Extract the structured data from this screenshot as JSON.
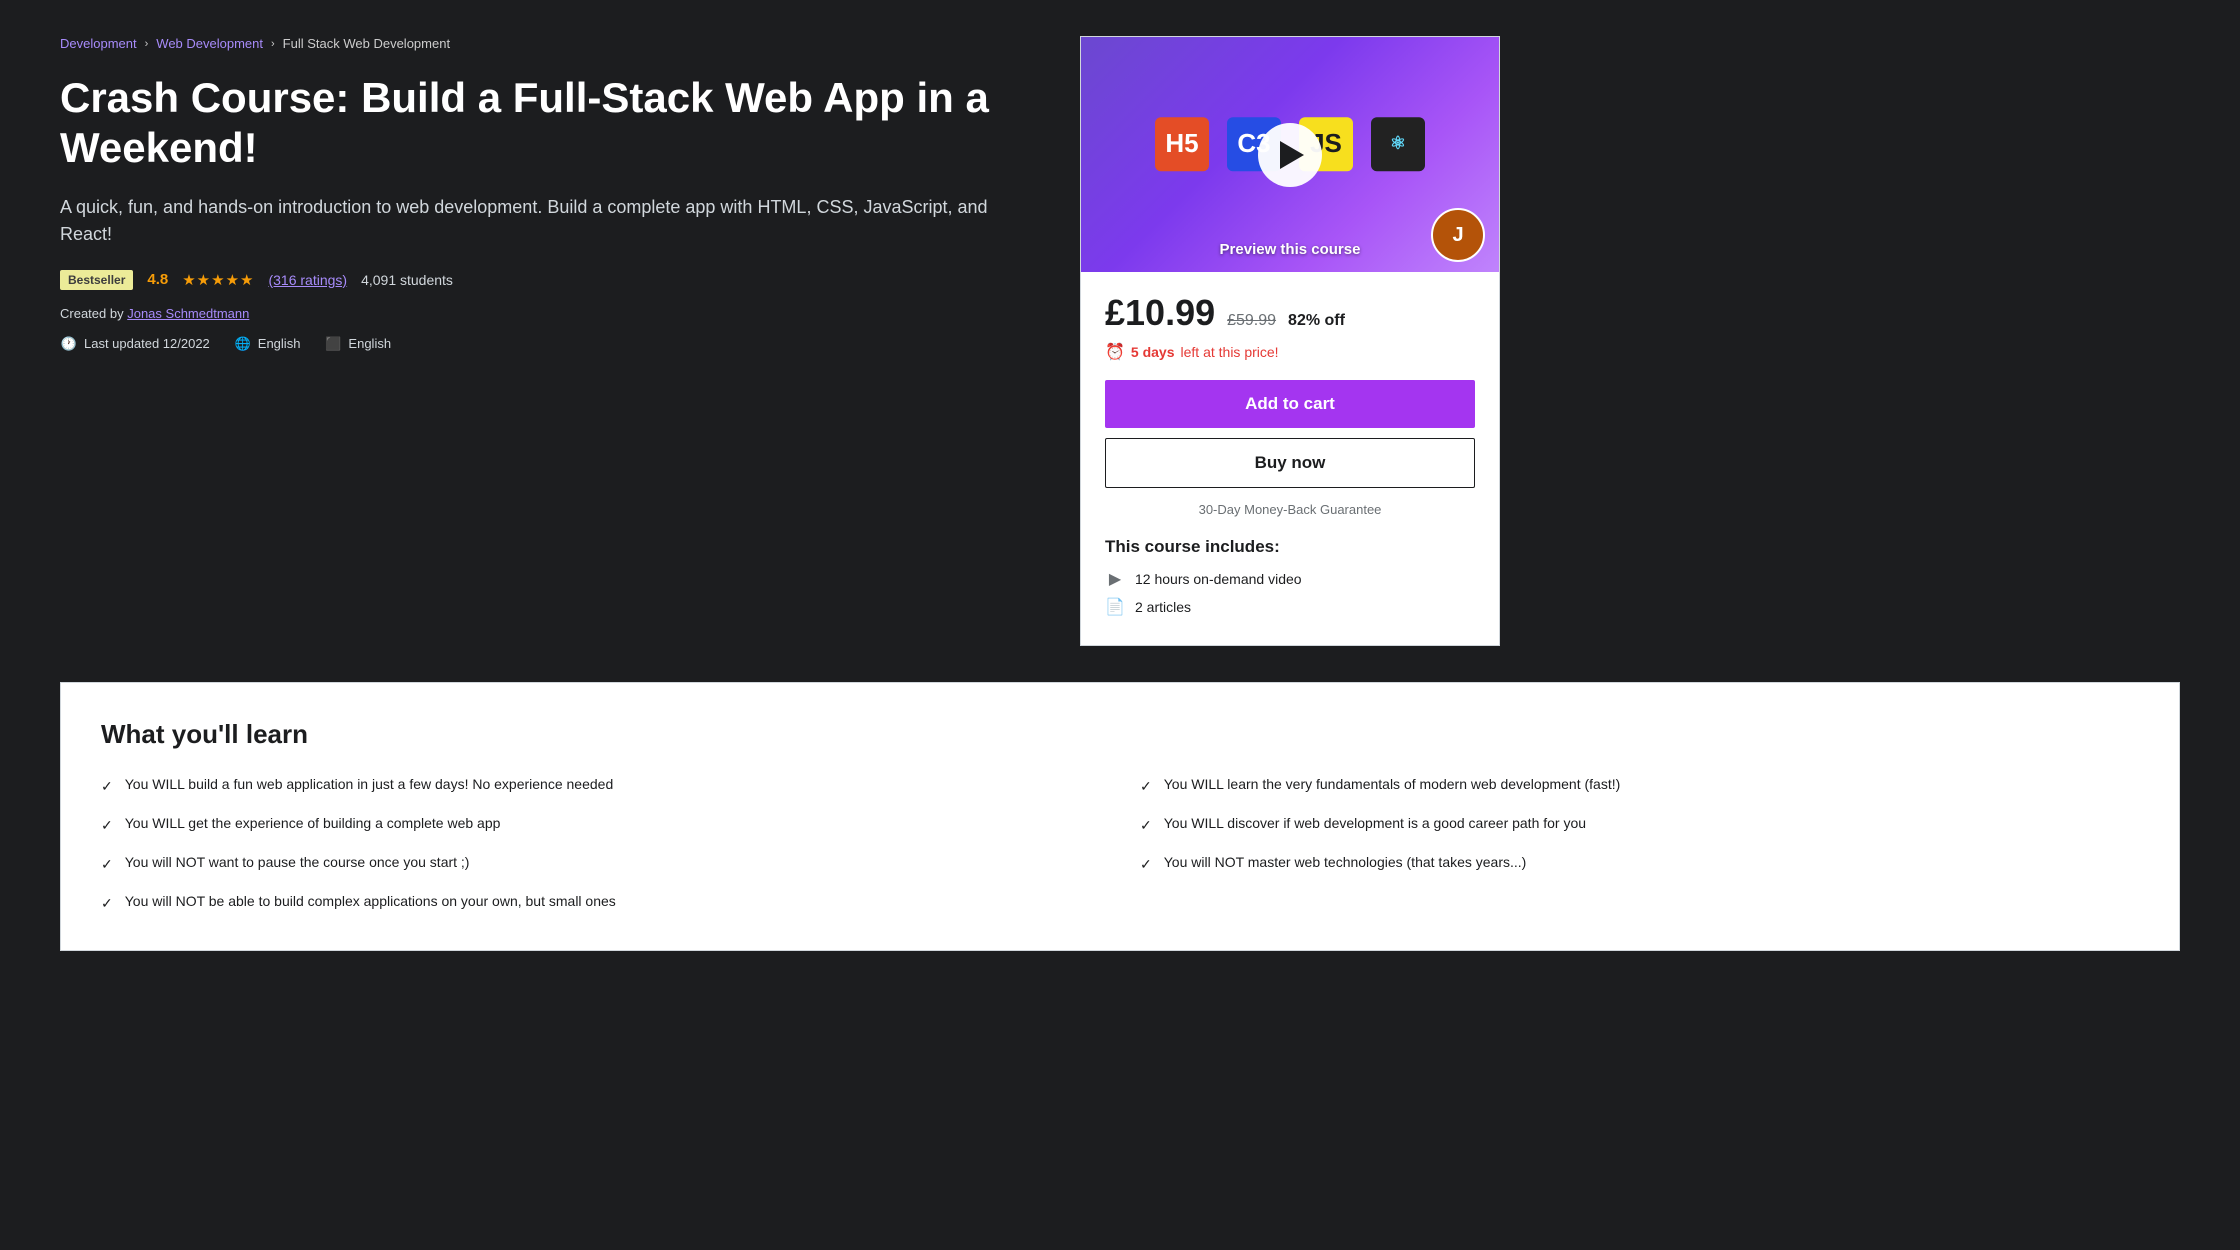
{
  "breadcrumb": {
    "items": [
      {
        "label": "Development",
        "link": true
      },
      {
        "label": "Web Development",
        "link": true
      },
      {
        "label": "Full Stack Web Development",
        "link": false
      }
    ]
  },
  "course": {
    "title": "Crash Course: Build a Full-Stack Web App in a Weekend!",
    "subtitle": "A quick, fun, and hands-on introduction to web development. Build a complete app with HTML, CSS, JavaScript, and React!",
    "badge": "Bestseller",
    "rating": "4.8",
    "stars": "★★★★★",
    "rating_count": "(316 ratings)",
    "students": "4,091 students",
    "creator_prefix": "Created by",
    "creator": "Jonas Schmedtmann",
    "last_updated_label": "Last updated 12/2022",
    "language": "English",
    "caption_language": "English"
  },
  "card": {
    "preview_label": "Preview this course",
    "current_price": "£10.99",
    "original_price": "£59.99",
    "discount": "82% off",
    "timer_days": "5 days",
    "timer_text": "left at this price!",
    "add_to_cart": "Add to cart",
    "buy_now": "Buy now",
    "guarantee": "30-Day Money-Back Guarantee",
    "includes_title": "This course includes:",
    "includes_items": [
      {
        "icon": "▶",
        "text": "12 hours on-demand video"
      },
      {
        "icon": "📄",
        "text": "2 articles"
      }
    ]
  },
  "learn_section": {
    "title": "What you'll learn",
    "items": [
      {
        "text": "You WILL build a fun web application in just a few days! No experience needed"
      },
      {
        "text": "You will NOT want to pause the course once you start ;)"
      },
      {
        "text": "You WILL learn the very fundamentals of modern web development (fast!)"
      },
      {
        "text": "You will NOT master web technologies (that takes years...)"
      },
      {
        "text": "You WILL get the experience of building a complete web app"
      },
      {
        "text": "You will NOT be able to build complex applications on your own, but small ones"
      },
      {
        "text": "You WILL discover if web development is a good career path for you"
      },
      {
        "text": ""
      }
    ]
  },
  "tech_icons": [
    {
      "label": "HTML",
      "abbr": "5"
    },
    {
      "label": "CSS",
      "abbr": "3"
    },
    {
      "label": "JS"
    },
    {
      "label": "React"
    }
  ]
}
